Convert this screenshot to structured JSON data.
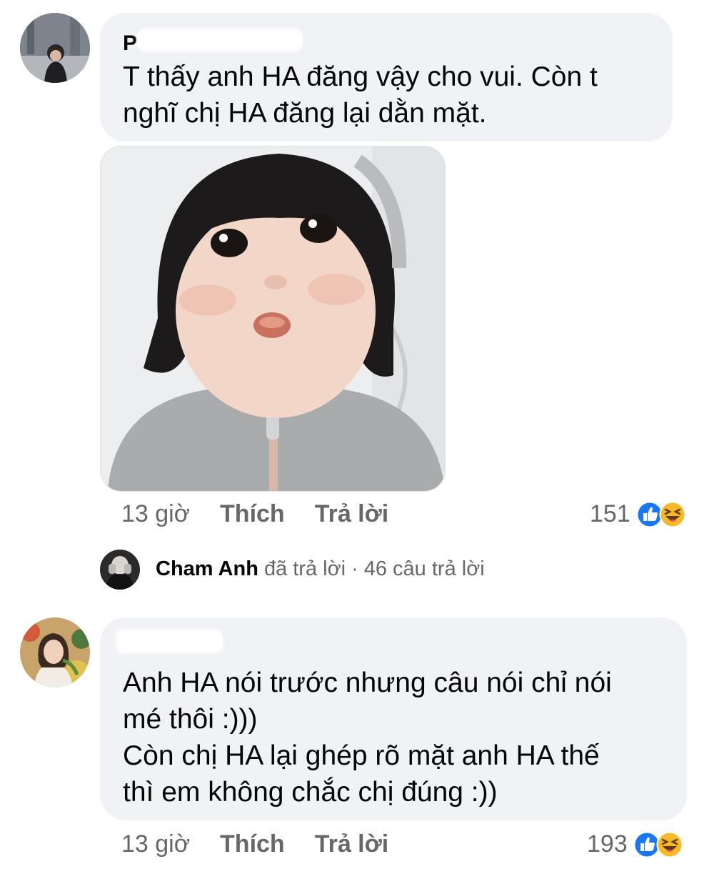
{
  "comments": [
    {
      "author": "P",
      "text": "T thấy anh HA đăng vậy cho vui. Còn t\nnghĩ chị HA đăng lại dằn mặt.",
      "time": "13 giờ",
      "like_label": "Thích",
      "reply_label": "Trả lời",
      "reaction_count": "151",
      "reaction_icons": [
        "like-icon",
        "haha-icon"
      ],
      "has_photo": true
    },
    {
      "author": "",
      "text": "Anh HA nói trước nhưng câu nói chỉ nói\nmé thôi :)))\nCòn chị HA lại ghép rõ mặt anh HA thế\nthì em không chắc chị đúng :))",
      "time": "13 giờ",
      "like_label": "Thích",
      "reply_label": "Trả lời",
      "reaction_count": "193",
      "reaction_icons": [
        "like-icon",
        "haha-icon"
      ]
    }
  ],
  "reply_summary": {
    "name": "Cham Anh",
    "action": "đã trả lời",
    "separator": "·",
    "count_text": "46 câu trả lời"
  },
  "colors": {
    "bubble": "#f0f2f5",
    "meta_text": "#65676b",
    "like_blue": "#1877f2",
    "haha_yellow": "#f7b928"
  }
}
